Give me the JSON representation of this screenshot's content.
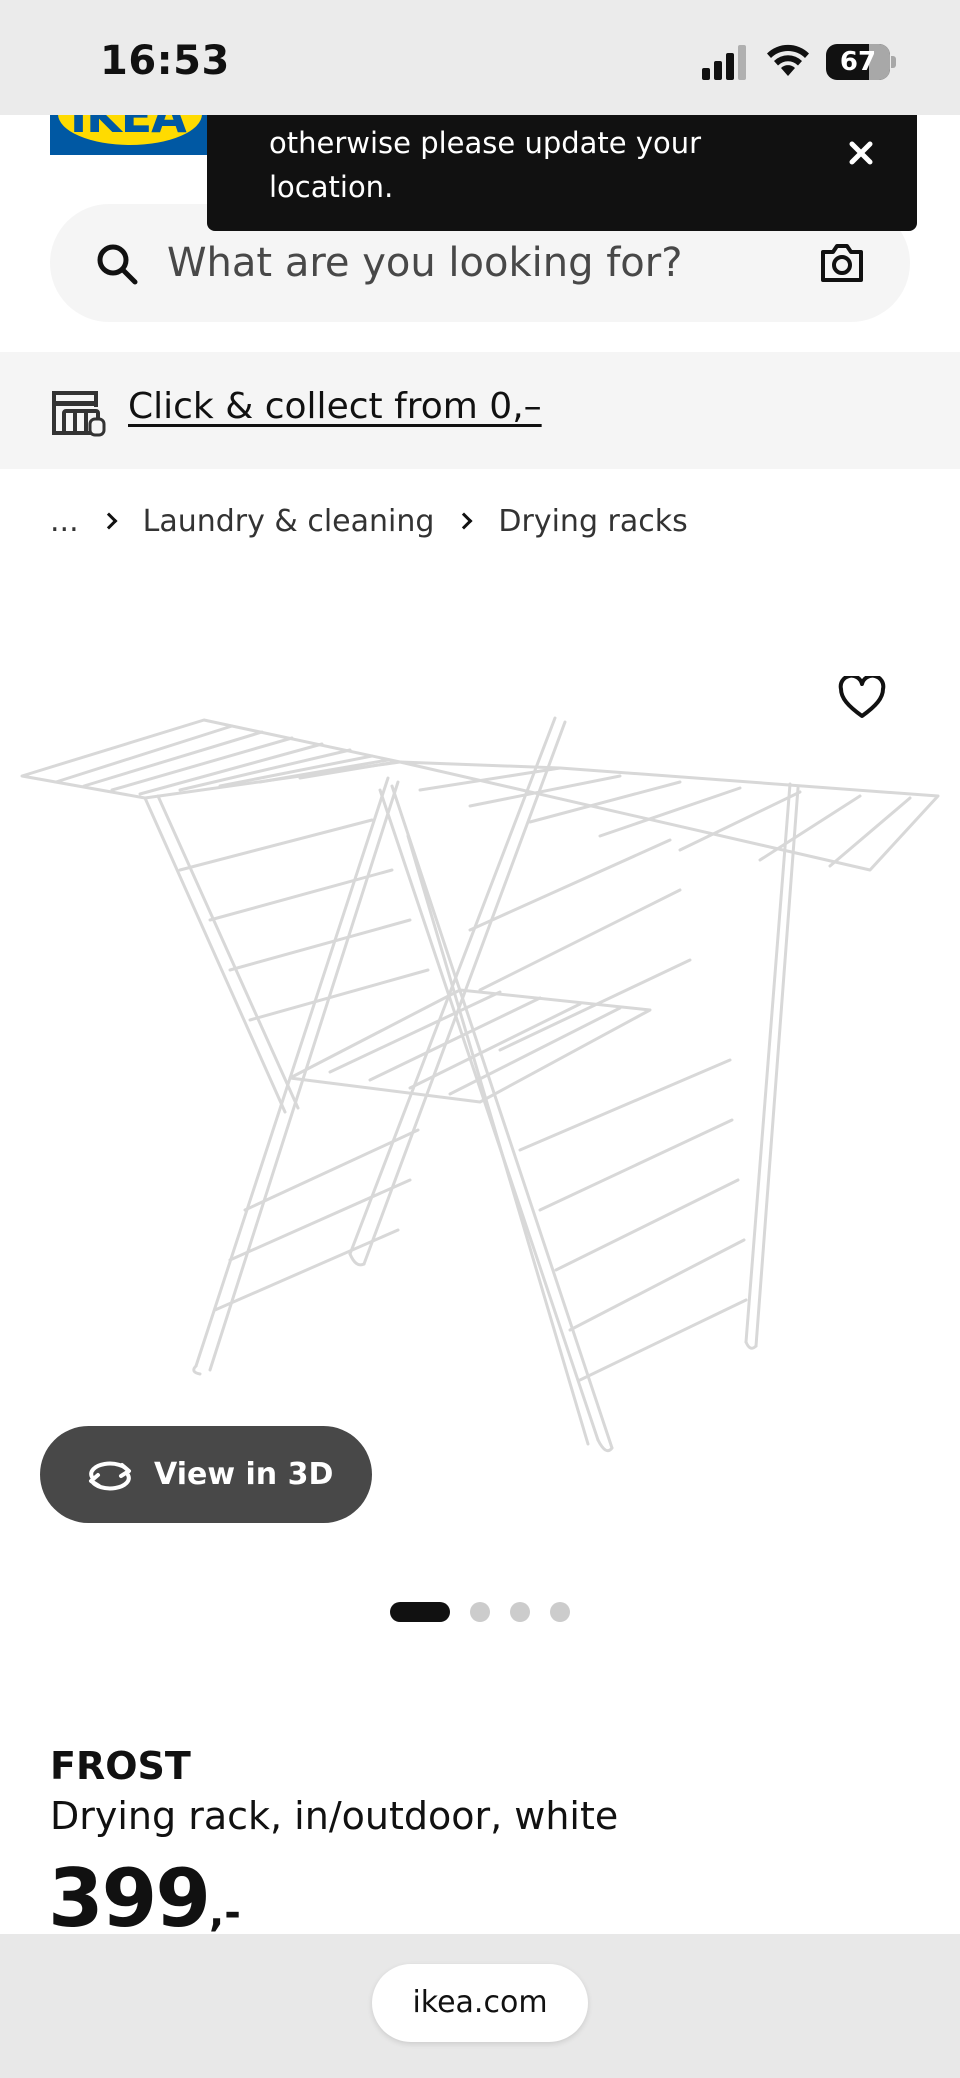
{
  "status_bar": {
    "time": "16:53",
    "battery_percent": "67",
    "battery_level": 0.67,
    "icons": [
      "cellular-signal-icon",
      "wifi-icon",
      "battery-icon"
    ]
  },
  "header": {
    "logo": "IKEA",
    "search": {
      "placeholder": "What are you looking for?",
      "icons": [
        "search-icon",
        "camera-icon"
      ]
    }
  },
  "toast": {
    "message": "otherwise please update your location.",
    "close_icon": "close-icon"
  },
  "click_collect": {
    "label": "Click & collect from 0,–",
    "icon": "store-icon"
  },
  "breadcrumb": {
    "items": [
      "...",
      "Laundry & cleaning",
      "Drying racks"
    ],
    "separator_icon": "chevron-right-icon"
  },
  "product": {
    "name": "FROST",
    "description": "Drying rack, in/outdoor, white",
    "price": "399",
    "price_suffix": ",-",
    "wishlist_icon": "heart-icon",
    "view_3d": {
      "label": "View in 3D",
      "icon": "rotate-3d-icon"
    },
    "carousel": {
      "count": 4,
      "active_index": 0
    }
  },
  "browser": {
    "url": "ikea.com"
  },
  "colors": {
    "status_bar_bg": "#ebebeb",
    "toast_bg": "#111111",
    "search_bg": "#f5f5f5",
    "button_dark": "#484848",
    "ikea_blue": "#0058a3",
    "ikea_yellow": "#ffdb00"
  }
}
